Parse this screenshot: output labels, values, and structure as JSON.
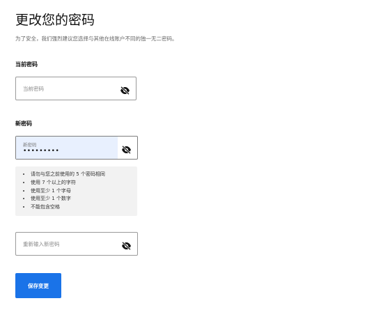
{
  "header": {
    "title": "更改您的密码",
    "subtitle": "为了安全，我们强烈建议您选择与其他在线账户不同的独一无二密码。"
  },
  "current_password": {
    "label": "当前密码",
    "placeholder": "当前密码",
    "icon": "eye-slash-icon"
  },
  "new_password": {
    "label": "新密码",
    "float_label": "新密码",
    "value": "•••••••••",
    "icon": "eye-slash-icon"
  },
  "requirements": [
    "请勿与您之前使用的 5 个密码相同",
    "使用 7 个以上的字符",
    "使用至少 1 个字母",
    "使用至少 1 个数字",
    "不能包含空格"
  ],
  "confirm_password": {
    "placeholder": "重新输入新密码",
    "icon": "eye-slash-icon"
  },
  "actions": {
    "save_label": "保存变更"
  },
  "colors": {
    "accent": "#1a73e8",
    "autofill": "#e8f0fe",
    "requirements_bg": "#f2f2f2"
  }
}
